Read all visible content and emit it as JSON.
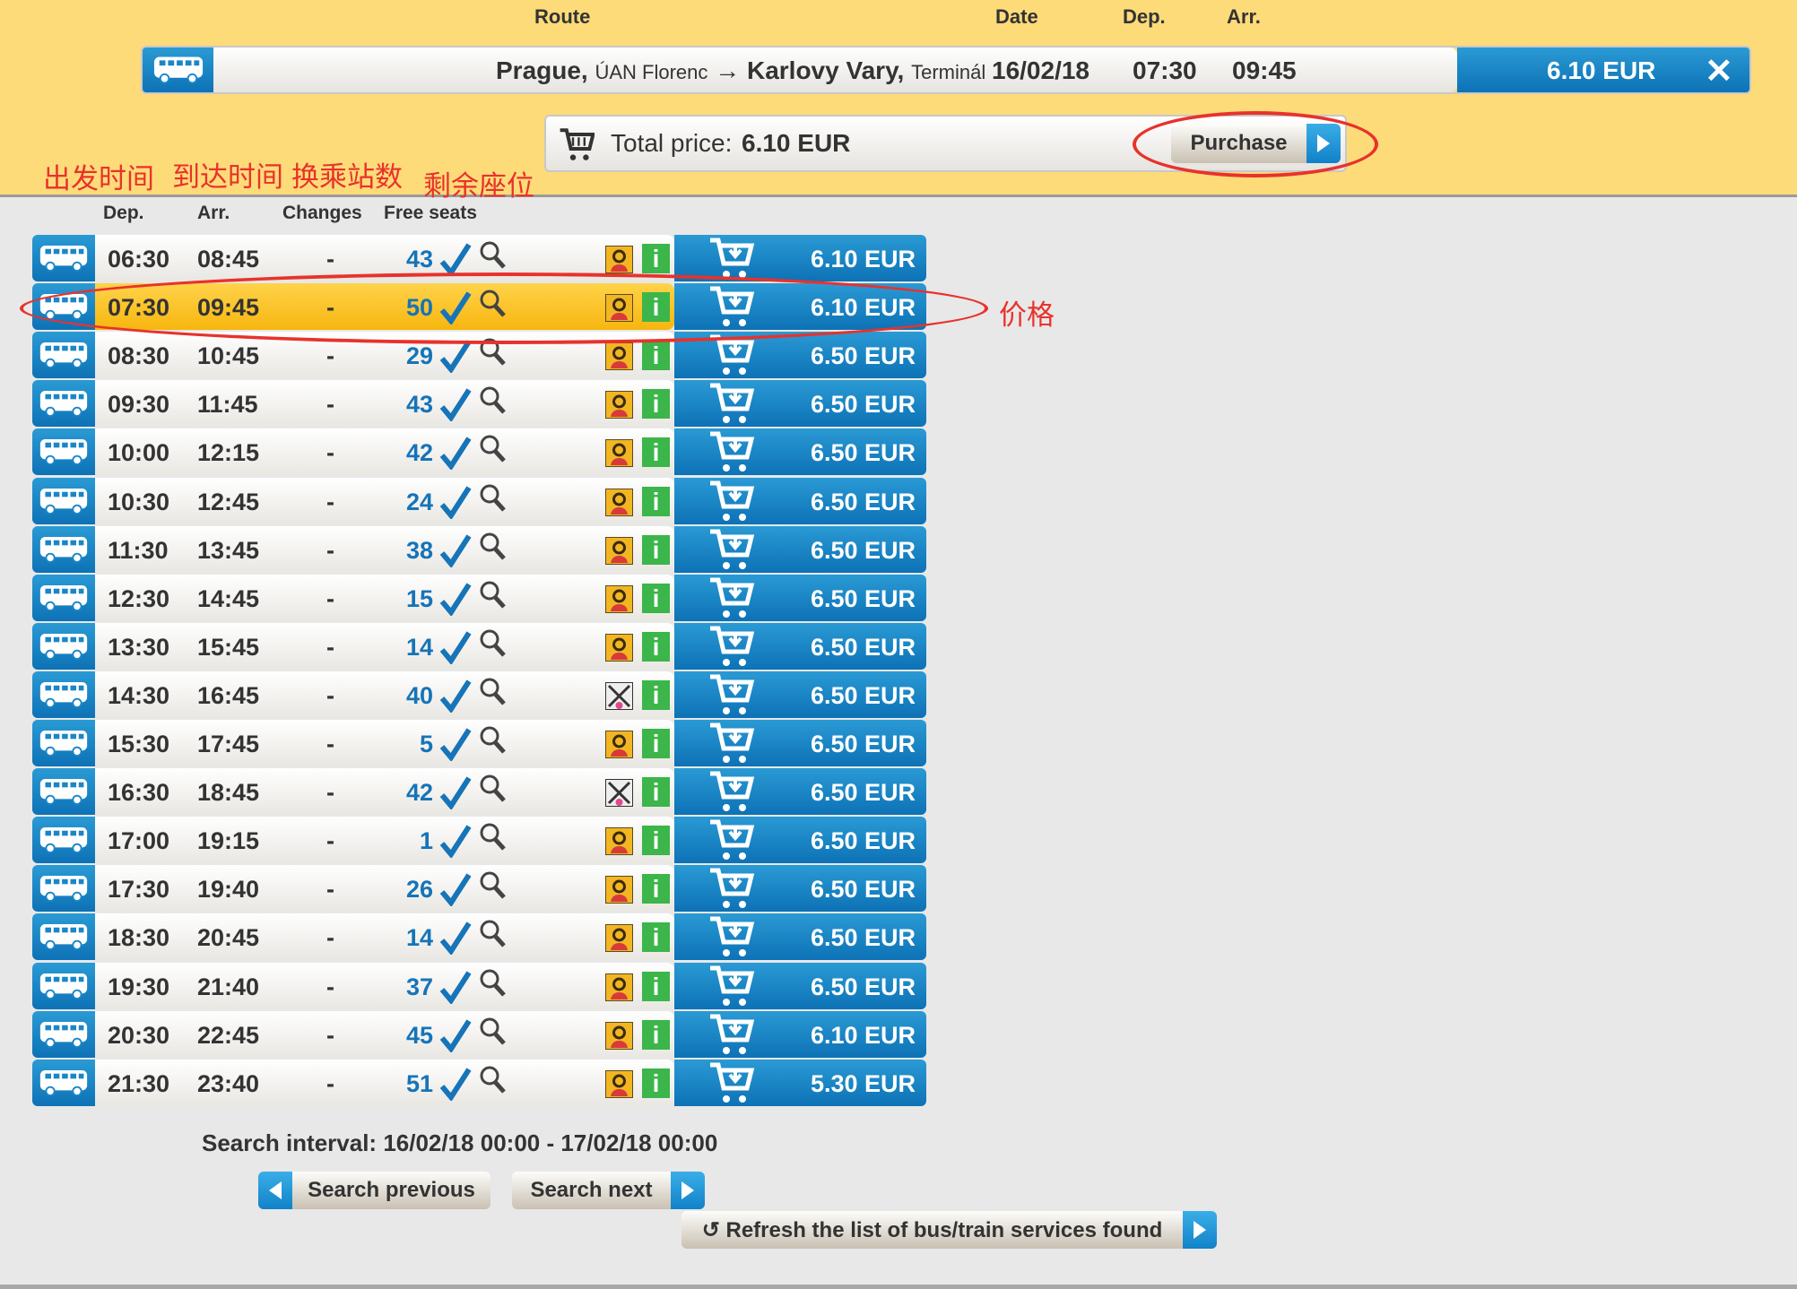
{
  "header": {
    "labels": {
      "route": "Route",
      "date": "Date",
      "dep": "Dep.",
      "arr": "Arr."
    },
    "selected": {
      "from_city": "Prague,",
      "from_station": "ÚAN Florenc",
      "arrow": "→",
      "to_city": "Karlovy Vary,",
      "to_station": "Terminál",
      "date": "16/02/18",
      "dep": "07:30",
      "arr": "09:45",
      "price": "6.10 EUR",
      "close_icon": "close-icon"
    },
    "total": {
      "label": "Total price:",
      "value": "6.10 EUR",
      "purchase": "Purchase"
    }
  },
  "annotations": {
    "dep": "出发时间",
    "arr": "到达时间",
    "changes": "换乘站数",
    "seats": "剩余座位",
    "price": "价格"
  },
  "columns": {
    "dep": "Dep.",
    "arr": "Arr.",
    "changes": "Changes",
    "seats": "Free seats"
  },
  "colors": {
    "accent": "#1a86c8",
    "header_bg": "#fedb79",
    "selected_row": "#f9c11f",
    "annotation": "#e8322c"
  },
  "connections": [
    {
      "dep": "06:30",
      "arr": "08:45",
      "changes": "-",
      "seats": "43",
      "accessible": true,
      "price": "6.10 EUR"
    },
    {
      "dep": "07:30",
      "arr": "09:45",
      "changes": "-",
      "seats": "50",
      "accessible": true,
      "price": "6.10 EUR",
      "selected": true
    },
    {
      "dep": "08:30",
      "arr": "10:45",
      "changes": "-",
      "seats": "29",
      "accessible": true,
      "price": "6.50 EUR"
    },
    {
      "dep": "09:30",
      "arr": "11:45",
      "changes": "-",
      "seats": "43",
      "accessible": true,
      "price": "6.50 EUR"
    },
    {
      "dep": "10:00",
      "arr": "12:15",
      "changes": "-",
      "seats": "42",
      "accessible": true,
      "price": "6.50 EUR"
    },
    {
      "dep": "10:30",
      "arr": "12:45",
      "changes": "-",
      "seats": "24",
      "accessible": true,
      "price": "6.50 EUR"
    },
    {
      "dep": "11:30",
      "arr": "13:45",
      "changes": "-",
      "seats": "38",
      "accessible": true,
      "price": "6.50 EUR"
    },
    {
      "dep": "12:30",
      "arr": "14:45",
      "changes": "-",
      "seats": "15",
      "accessible": true,
      "price": "6.50 EUR"
    },
    {
      "dep": "13:30",
      "arr": "15:45",
      "changes": "-",
      "seats": "14",
      "accessible": true,
      "price": "6.50 EUR"
    },
    {
      "dep": "14:30",
      "arr": "16:45",
      "changes": "-",
      "seats": "40",
      "accessible": false,
      "price": "6.50 EUR"
    },
    {
      "dep": "15:30",
      "arr": "17:45",
      "changes": "-",
      "seats": "5",
      "accessible": true,
      "price": "6.50 EUR"
    },
    {
      "dep": "16:30",
      "arr": "18:45",
      "changes": "-",
      "seats": "42",
      "accessible": false,
      "price": "6.50 EUR"
    },
    {
      "dep": "17:00",
      "arr": "19:15",
      "changes": "-",
      "seats": "1",
      "accessible": true,
      "price": "6.50 EUR"
    },
    {
      "dep": "17:30",
      "arr": "19:40",
      "changes": "-",
      "seats": "26",
      "accessible": true,
      "price": "6.50 EUR"
    },
    {
      "dep": "18:30",
      "arr": "20:45",
      "changes": "-",
      "seats": "14",
      "accessible": true,
      "price": "6.50 EUR"
    },
    {
      "dep": "19:30",
      "arr": "21:40",
      "changes": "-",
      "seats": "37",
      "accessible": true,
      "price": "6.50 EUR"
    },
    {
      "dep": "20:30",
      "arr": "22:45",
      "changes": "-",
      "seats": "45",
      "accessible": true,
      "price": "6.10 EUR"
    },
    {
      "dep": "21:30",
      "arr": "23:40",
      "changes": "-",
      "seats": "51",
      "accessible": true,
      "price": "5.30 EUR"
    }
  ],
  "footer": {
    "interval": "Search interval: 16/02/18 00:00 - 17/02/18 00:00",
    "prev": "Search previous",
    "next": "Search next",
    "refresh_icon": "↺",
    "refresh": "Refresh the list of bus/train services found"
  }
}
